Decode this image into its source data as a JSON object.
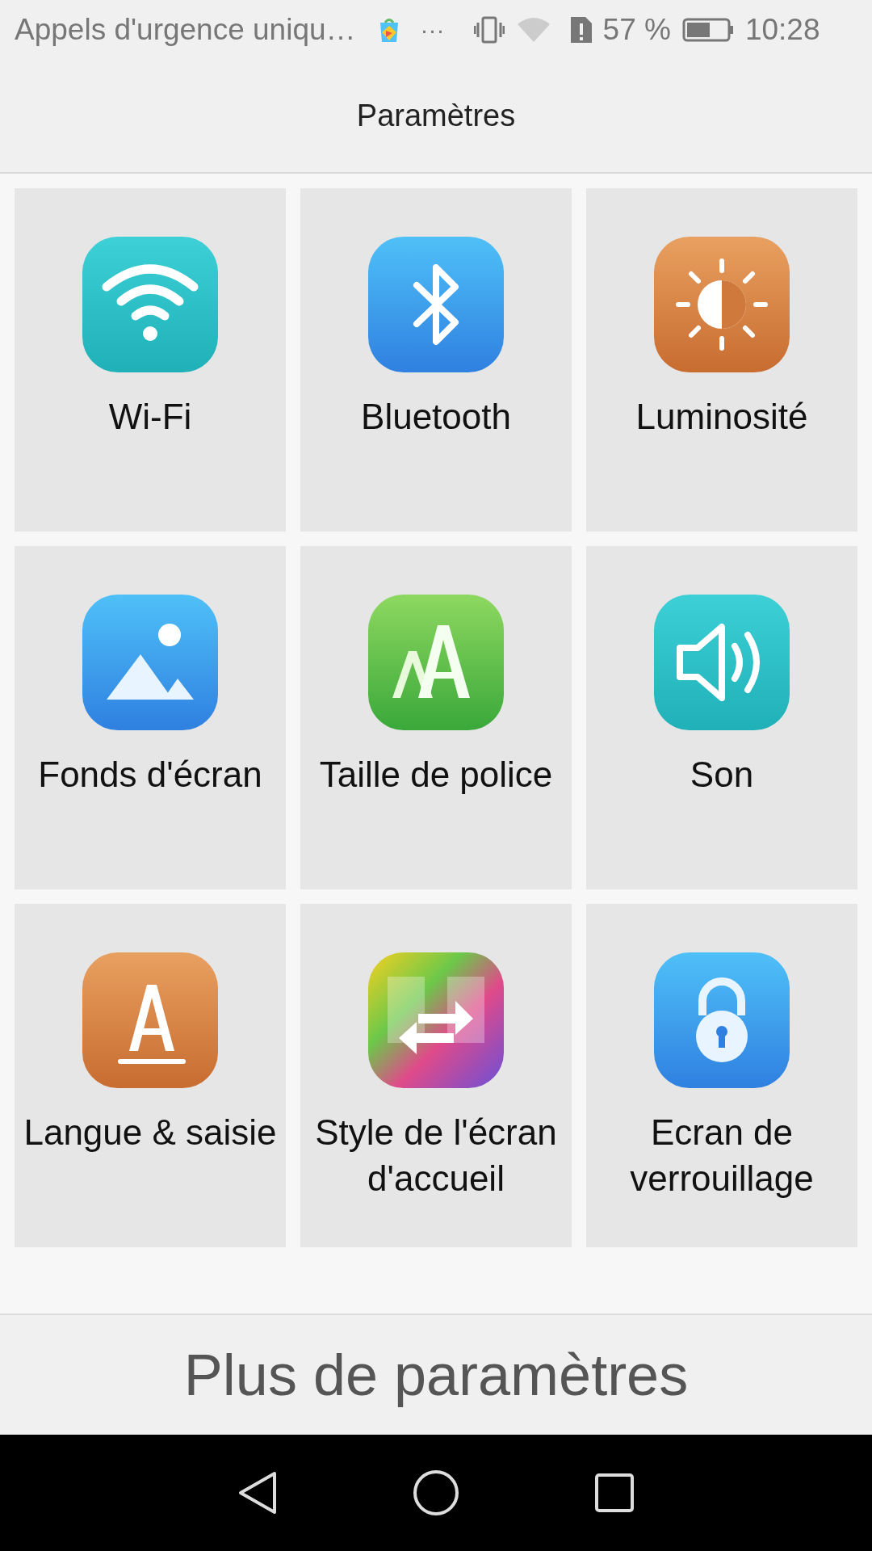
{
  "status_bar": {
    "notification": "Appels d'urgence uniqu…",
    "more": "···",
    "battery_percent": "57 %",
    "time": "10:28"
  },
  "title": "Paramètres",
  "tiles": [
    {
      "label": "Wi-Fi",
      "kind": "wifi"
    },
    {
      "label": "Bluetooth",
      "kind": "bluetooth"
    },
    {
      "label": "Luminosité",
      "kind": "brightness"
    },
    {
      "label": "Fonds d'écran",
      "kind": "wallpaper"
    },
    {
      "label": "Taille de police",
      "kind": "font_size"
    },
    {
      "label": "Son",
      "kind": "sound"
    },
    {
      "label": "Langue & saisie",
      "kind": "language"
    },
    {
      "label": "Style de l'écran d'accueil",
      "kind": "home_style"
    },
    {
      "label": "Ecran de verrouillage",
      "kind": "lock"
    }
  ],
  "more_button": "Plus de paramètres"
}
